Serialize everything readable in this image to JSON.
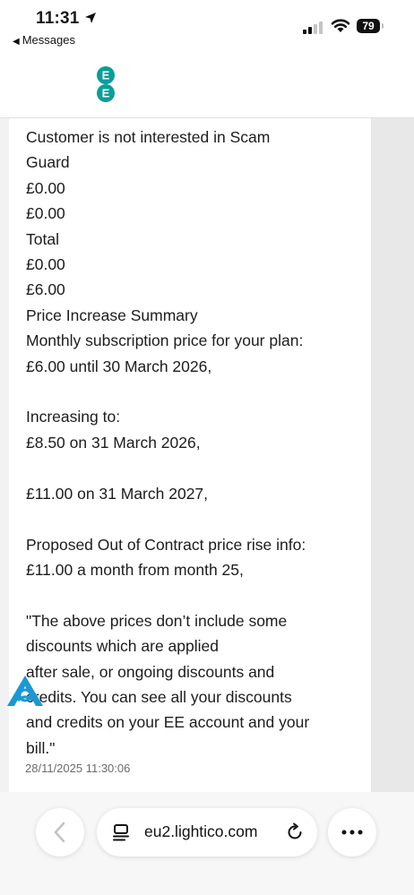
{
  "status_bar": {
    "time": "11:31",
    "back_app": "Messages",
    "battery": "79"
  },
  "header": {
    "logo_letters": [
      "E",
      "E"
    ]
  },
  "message": {
    "text": "Customer is not interested in Scam\nGuard\n£0.00\n£0.00\nTotal\n£0.00\n£6.00\nPrice Increase Summary\nMonthly subscription price for your plan:\n£6.00 until 30 March 2026,\n\nIncreasing to:\n£8.50 on 31 March 2026,\n\n£11.00 on 31 March 2027,\n\nProposed Out of Contract price rise info:\n£11.00 a month from month 25,\n\n\"The above prices don’t include some\ndiscounts which are applied\nafter sale, or ongoing discounts and\ncredits. You can see all your discounts\nand credits on your EE account and your\nbill.\"",
    "timestamp": "28/11/2025 11:30:06"
  },
  "browser": {
    "url": "eu2.lightico.com"
  },
  "colors": {
    "brand": "#0a9e9a",
    "accessibility": "#1b98d4"
  }
}
